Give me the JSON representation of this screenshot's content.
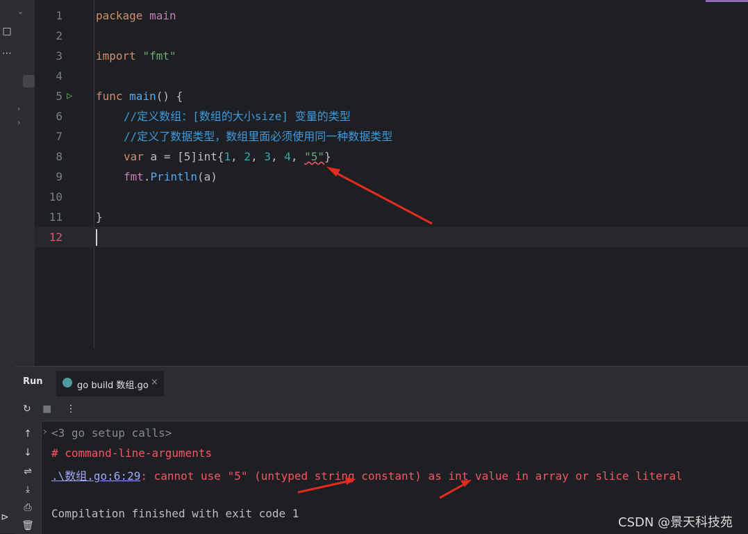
{
  "editor": {
    "lines": [
      {
        "n": "1"
      },
      {
        "n": "2"
      },
      {
        "n": "3"
      },
      {
        "n": "4"
      },
      {
        "n": "5"
      },
      {
        "n": "6"
      },
      {
        "n": "7"
      },
      {
        "n": "8"
      },
      {
        "n": "9"
      },
      {
        "n": "10"
      },
      {
        "n": "11"
      },
      {
        "n": "12"
      }
    ],
    "code": {
      "l1_kw": "package",
      "l1_name": "main",
      "l3_kw": "import",
      "l3_str": "\"fmt\"",
      "l5_kw": "func",
      "l5_fn": "main",
      "l5_rest": "() {",
      "l6_comment": "//定义数组：[数组的大小size] 变量的类型",
      "l7_comment": "//定义了数据类型，数组里面必须使用同一种数据类型",
      "l8_kw": "var",
      "l8_a": "a = ",
      "l8_b": "[5]int{",
      "l8_n1": "1",
      "l8_c1": ", ",
      "l8_n2": "2",
      "l8_c2": ", ",
      "l8_n3": "3",
      "l8_c3": ", ",
      "l8_n4": "4",
      "l8_c4": ", ",
      "l8_str": "\"5\"",
      "l8_end": "}",
      "l9_pkg": "fmt",
      "l9_dot": ".",
      "l9_fn": "Println",
      "l9_rest": "(a)",
      "l11": "}"
    }
  },
  "run_panel": {
    "title": "Run",
    "tab_label": "go build 数组.go",
    "tab_close": "×",
    "console": {
      "setup": "<3 go setup calls>",
      "header": "# command-line-arguments",
      "error_link": ".\\数组.go:6:29",
      "error_msg": ": cannot use \"5\" (untyped string constant) as int value in array or slice literal",
      "finished": "Compilation finished with exit code 1"
    }
  },
  "watermark": "CSDN @景天科技苑"
}
